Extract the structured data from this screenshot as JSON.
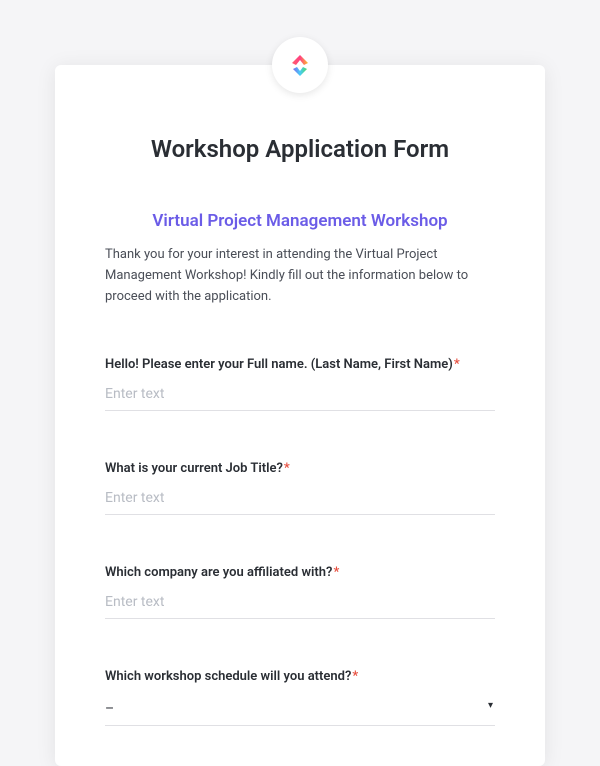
{
  "form": {
    "title": "Workshop Application Form",
    "subtitle": "Virtual Project Management Workshop",
    "intro": "Thank you for your interest in attending the Virtual Project Management Workshop! Kindly fill out the information below to proceed with the application.",
    "fields": {
      "fullname": {
        "label": "Hello! Please enter your Full name. (Last Name, First Name)",
        "placeholder": "Enter text",
        "value": "",
        "required": true
      },
      "jobtitle": {
        "label": "What is your current Job Title?",
        "placeholder": "Enter text",
        "value": "",
        "required": true
      },
      "company": {
        "label": "Which company are you affiliated with?",
        "placeholder": "Enter text",
        "value": "",
        "required": true
      },
      "schedule": {
        "label": "Which workshop schedule will you attend?",
        "selected": "–",
        "required": true
      }
    },
    "required_mark": "*"
  },
  "icons": {
    "logo": "clickup-logo",
    "dropdown_caret": "▾"
  },
  "colors": {
    "accent_purple": "#6b5ce7",
    "required_red": "#e74c3c"
  }
}
